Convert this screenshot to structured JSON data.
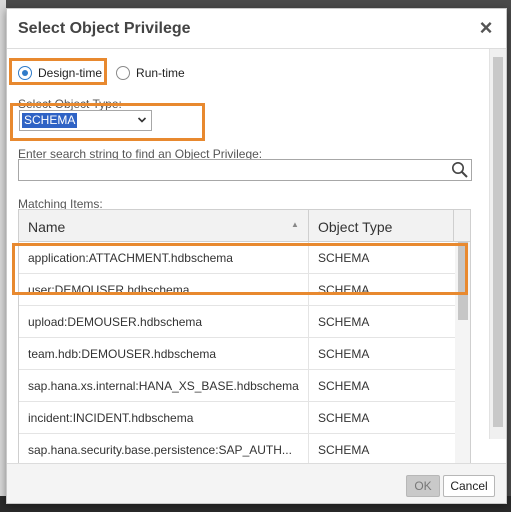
{
  "dialog": {
    "title": "Select Object Privilege",
    "close_label": "×"
  },
  "mode": {
    "options": [
      {
        "label": "Design-time",
        "checked": true
      },
      {
        "label": "Run-time",
        "checked": false
      }
    ]
  },
  "object_type": {
    "label": "Select Object Type:",
    "value": "SCHEMA"
  },
  "search": {
    "label": "Enter search string to find an Object Privilege:",
    "value": "",
    "icon": "search-icon"
  },
  "results": {
    "label": "Matching Items:",
    "columns": [
      "Name",
      "Object Type"
    ],
    "rows": [
      {
        "name": "application:ATTACHMENT.hdbschema",
        "type": "SCHEMA"
      },
      {
        "name": "user:DEMOUSER.hdbschema",
        "type": "SCHEMA"
      },
      {
        "name": "upload:DEMOUSER.hdbschema",
        "type": "SCHEMA"
      },
      {
        "name": "team.hdb:DEMOUSER.hdbschema",
        "type": "SCHEMA"
      },
      {
        "name": "sap.hana.xs.internal:HANA_XS_BASE.hdbschema",
        "type": "SCHEMA"
      },
      {
        "name": "incident:INCIDENT.hdbschema",
        "type": "SCHEMA"
      },
      {
        "name": "sap.hana.security.base.persistence:SAP_AUTH...",
        "type": "SCHEMA"
      },
      {
        "name": "",
        "type": ""
      }
    ]
  },
  "footer": {
    "ok_label": "OK",
    "cancel_label": "Cancel"
  },
  "colors": {
    "highlight": "#e8892f",
    "selection": "#2f63c5",
    "radio_accent": "#2f7bc9"
  }
}
